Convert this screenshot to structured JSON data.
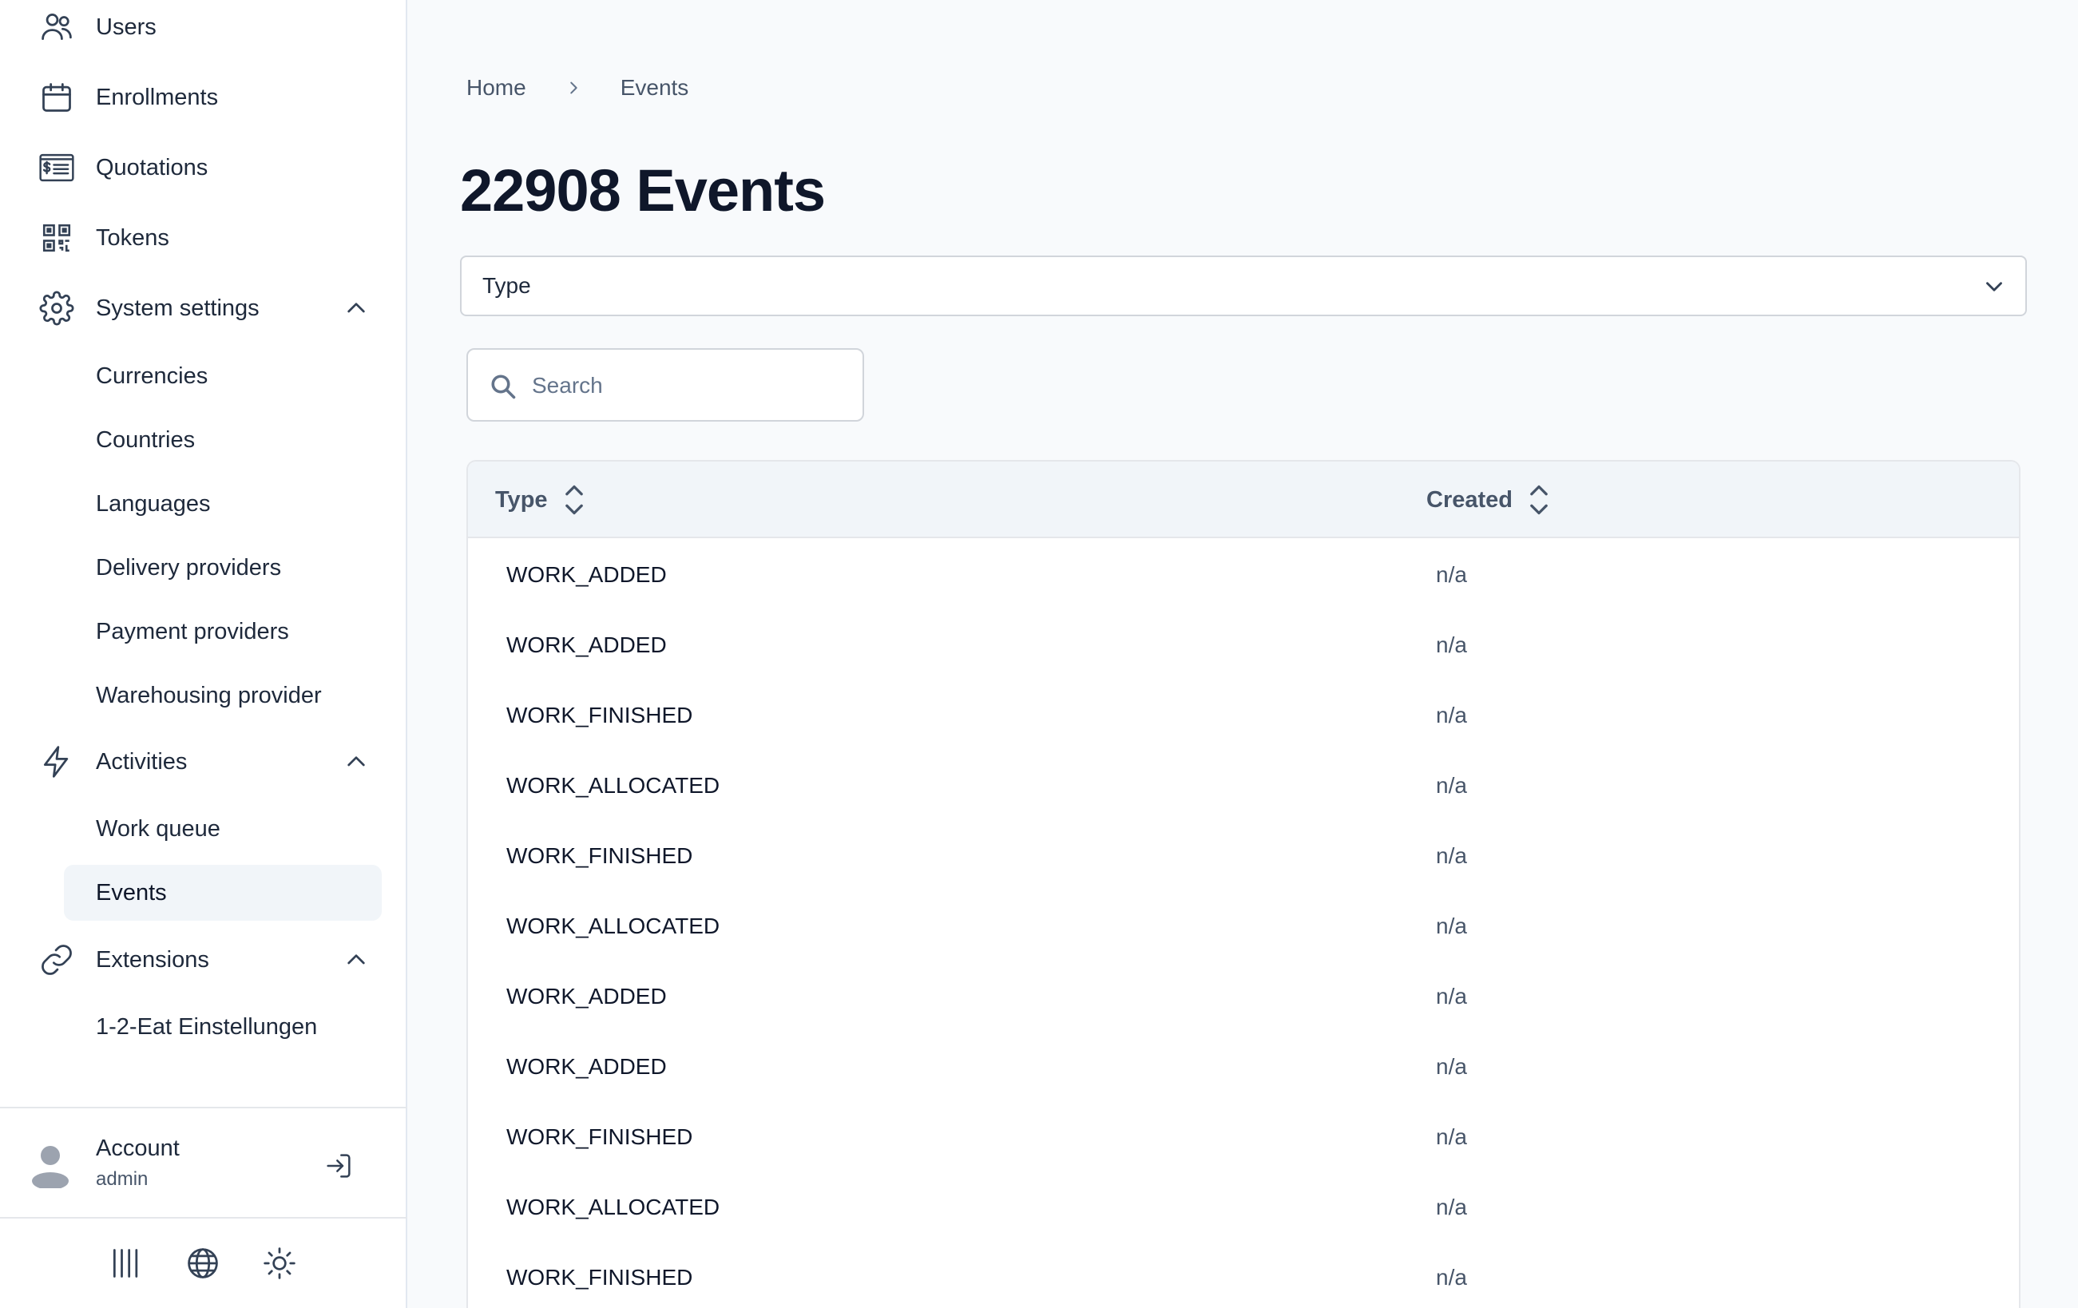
{
  "sidebar": {
    "nav": {
      "users": "Users",
      "enrollments": "Enrollments",
      "quotations": "Quotations",
      "tokens": "Tokens",
      "system_settings": "System settings",
      "activities": "Activities",
      "extensions": "Extensions"
    },
    "system_settings_items": [
      "Currencies",
      "Countries",
      "Languages",
      "Delivery providers",
      "Payment providers",
      "Warehousing provider"
    ],
    "activities_items": [
      "Work queue",
      "Events"
    ],
    "active_item": "Events",
    "extensions_items": [
      "1-2-Eat Einstellungen"
    ],
    "account": {
      "name": "Account",
      "role": "admin"
    },
    "bottom_icons": [
      "barcode-icon",
      "globe-icon",
      "sun-icon"
    ]
  },
  "breadcrumb": {
    "home": "Home",
    "current": "Events"
  },
  "page": {
    "title": "22908 Events"
  },
  "filter": {
    "type_select": "Type"
  },
  "search": {
    "placeholder": "Search",
    "value": ""
  },
  "table": {
    "columns": {
      "type": "Type",
      "created": "Created"
    },
    "rows": [
      {
        "type": "WORK_ADDED",
        "created": "n/a"
      },
      {
        "type": "WORK_ADDED",
        "created": "n/a"
      },
      {
        "type": "WORK_FINISHED",
        "created": "n/a"
      },
      {
        "type": "WORK_ALLOCATED",
        "created": "n/a"
      },
      {
        "type": "WORK_FINISHED",
        "created": "n/a"
      },
      {
        "type": "WORK_ALLOCATED",
        "created": "n/a"
      },
      {
        "type": "WORK_ADDED",
        "created": "n/a"
      },
      {
        "type": "WORK_ADDED",
        "created": "n/a"
      },
      {
        "type": "WORK_FINISHED",
        "created": "n/a"
      },
      {
        "type": "WORK_ALLOCATED",
        "created": "n/a"
      },
      {
        "type": "WORK_FINISHED",
        "created": "n/a"
      }
    ]
  }
}
